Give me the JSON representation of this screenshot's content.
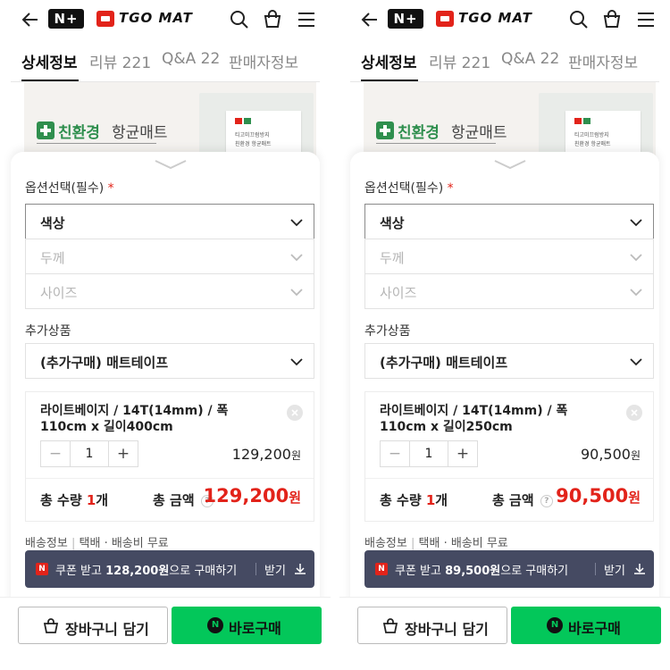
{
  "colors": {
    "accent_red": "#e2231a",
    "naver_green": "#03c75a",
    "coupon_bg": "#454a62",
    "eco_green": "#2f8f4e"
  },
  "header": {
    "logo_nplus": "N+",
    "brand": "TGO MAT",
    "icons": [
      "back-arrow-icon",
      "search-icon",
      "cart-icon",
      "menu-icon"
    ]
  },
  "tabs": [
    {
      "label": "상세정보",
      "active": true
    },
    {
      "label": "리뷰 221",
      "active": false
    },
    {
      "label": "Q&A 22",
      "active": false
    },
    {
      "label": "판매자정보",
      "active": false
    }
  ],
  "banner": {
    "eco": "친환경",
    "rest": "항균매트",
    "pkg_line1": "티고미끄럼방지",
    "pkg_line2": "친환경 항균매트"
  },
  "options": {
    "label": "옵션선택(필수)",
    "required_mark": "*",
    "selects": [
      {
        "text": "색상",
        "state": "active"
      },
      {
        "text": "두께",
        "state": "disabled"
      },
      {
        "text": "사이즈",
        "state": "disabled"
      }
    ]
  },
  "extra": {
    "label": "추가상품",
    "select": "(추가구매) 매트테이프"
  },
  "panels": [
    {
      "item": {
        "name": "라이트베이지 / 14T(14mm) / 폭 110cm x 길이400cm",
        "qty": "1",
        "price": "129,200",
        "currency": "원"
      },
      "summary": {
        "qty_label": "총 수량",
        "qty_value": "1",
        "qty_unit": "개",
        "amount_label": "총 금액",
        "amount": "129,200",
        "currency": "원"
      },
      "coupon": {
        "prefix": "쿠폰 받고 ",
        "amount": "128,200원",
        "suffix": "으로 구매하기",
        "get": "받기"
      }
    },
    {
      "item": {
        "name": "라이트베이지 / 14T(14mm) / 폭 110cm x 길이250cm",
        "qty": "1",
        "price": "90,500",
        "currency": "원"
      },
      "summary": {
        "qty_label": "총 수량",
        "qty_value": "1",
        "qty_unit": "개",
        "amount_label": "총 금액",
        "amount": "90,500",
        "currency": "원"
      },
      "coupon": {
        "prefix": "쿠폰 받고 ",
        "amount": "89,500원",
        "suffix": "으로 구매하기",
        "get": "받기"
      }
    }
  ],
  "shipping": {
    "label": "배송정보",
    "sep": "|",
    "method": "택배 · 배송비 무료"
  },
  "buttons": {
    "cart": "장바구니 담기",
    "buy": "바로구매",
    "buy_badge": "N"
  }
}
